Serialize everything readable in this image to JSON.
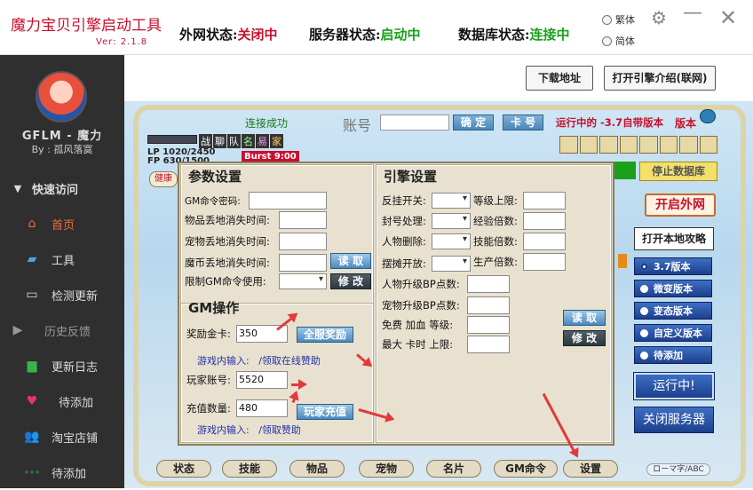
{
  "header": {
    "title": "魔力宝贝引擎启动工具",
    "version": "Ver: 2.1.8",
    "status": [
      {
        "label": "外网状态:",
        "value": "关闭中",
        "color": "#c8102e"
      },
      {
        "label": "服务器状态:",
        "value": "启动中",
        "color": "#1aa01a"
      },
      {
        "label": "数据库状态:",
        "value": "连接中",
        "color": "#1aa01a"
      }
    ],
    "lang_options": [
      "繁体",
      "简体"
    ],
    "window_buttons": [
      "gear-icon",
      "minimize-icon",
      "close-icon"
    ]
  },
  "sidebar": {
    "brand": "GFLM - 魔力",
    "author": "By : 孤风落寞",
    "section": "快速访问",
    "items": [
      {
        "label": "首页",
        "icon": "home-icon",
        "active": true
      },
      {
        "label": "工具",
        "icon": "folder-icon"
      },
      {
        "label": "检测更新",
        "icon": "monitor-icon"
      },
      {
        "label": "历史反馈",
        "icon": "play-icon"
      },
      {
        "label": "更新日志",
        "icon": "chat-icon"
      },
      {
        "label": "待添加",
        "icon": "heart-icon"
      },
      {
        "label": "淘宝店铺",
        "icon": "users-icon"
      },
      {
        "label": "待添加",
        "icon": "dots-icon"
      }
    ]
  },
  "toolbar": {
    "download": "下载地址",
    "intro": "打开引擎介绍(联网)"
  },
  "game_top": {
    "connect": "连接成功",
    "account_label": "账号",
    "confirm": "确 定",
    "card_no": "卡 号",
    "running": "运行中的 -3.7自带版本",
    "version": "版本",
    "lp": "LP 1020/2450",
    "fp": "FP 630/1500",
    "burst": "Burst 9:00",
    "tabs_top": [
      "战",
      "聊",
      "队",
      "名",
      "易",
      "家"
    ],
    "health": "健康"
  },
  "params": {
    "title": "参数设置",
    "fields": [
      {
        "label": "GM命令密码:",
        "value": ""
      },
      {
        "label": "物品丢地消失时间:",
        "value": ""
      },
      {
        "label": "宠物丢地消失时间:",
        "value": ""
      },
      {
        "label": "魔币丢地消失时间:",
        "value": ""
      },
      {
        "label": "限制GM命令使用:",
        "value": ""
      }
    ],
    "read": "读 取",
    "modify": "修 改"
  },
  "gm": {
    "title": "GM操作",
    "reward_label": "奖励金卡:",
    "reward_value": "350",
    "reward_btn": "全服奖励",
    "hint1_a": "游戏内输入:",
    "hint1_b": "/领取在线赞助",
    "player_label": "玩家账号:",
    "player_value": "5520",
    "amount_label": "充值数量:",
    "amount_value": "480",
    "recharge_btn": "玩家充值",
    "hint2_a": "游戏内输入:",
    "hint2_b": "/领取赞助"
  },
  "engine": {
    "title": "引擎设置",
    "left": [
      {
        "label": "反挂开关:"
      },
      {
        "label": "封号处理:"
      },
      {
        "label": "人物删除:"
      },
      {
        "label": "摆摊开放:"
      }
    ],
    "right": [
      "等级上限:",
      "经验倍数:",
      "技能倍数:",
      "生产倍数:"
    ],
    "rows": [
      "人物升级BP点数:",
      "宠物升级BP点数:",
      "免费 加血 等级:",
      "最大 卡时 上限:"
    ],
    "read": "读 取",
    "modify": "修 改"
  },
  "right": {
    "stop_db": "停止数据库",
    "open_net": "开启外网",
    "open_local": "打开本地攻略",
    "versions": [
      "3.7版本",
      "微变版本",
      "变态版本",
      "自定义版本",
      "待添加"
    ],
    "running": "运行中!",
    "close_server": "关闭服务器"
  },
  "bottom_tabs": [
    "状态",
    "技能",
    "物品",
    "宠物",
    "名片",
    "GM命令",
    "设置"
  ],
  "bottom_right": "ローマ字/ABC"
}
